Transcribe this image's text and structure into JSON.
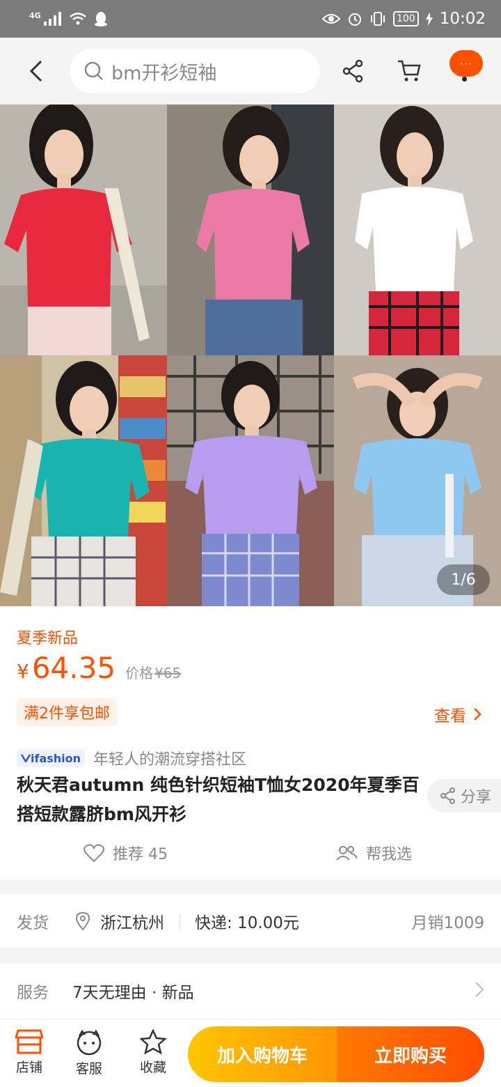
{
  "status_bar": {
    "network": "4G",
    "battery": "100",
    "time": "10:02"
  },
  "search": {
    "query": "bm开衫短袖"
  },
  "gallery": {
    "counter": "1/6",
    "shirt_colors": [
      "#e8283c",
      "#ec7aa6",
      "#ffffff",
      "#18b5b0",
      "#b79cf0",
      "#8ec7f0"
    ]
  },
  "product": {
    "promo_tag": "夏季新品",
    "currency": "¥",
    "price": "64.35",
    "original_price_label": "价格",
    "original_price": "¥65",
    "shipping_badge": "满2件享包邮",
    "view_label": "查看",
    "brand_logo": "ifashion",
    "brand_tagline": "年轻人的潮流穿搭社区",
    "title": "秋天君autumn 纯色针织短袖T恤女2020年夏季百搭短款露脐bm风开衫",
    "share_label": "分享",
    "recommend_label": "推荐 45",
    "help_choose_label": "帮我选"
  },
  "delivery": {
    "label": "发货",
    "city": "浙江杭州",
    "express": "快递: 10.00元",
    "monthly_sales": "月销1009"
  },
  "service": {
    "label": "服务",
    "value": "7天无理由 · 新品"
  },
  "bottom_bar": {
    "shop_label": "店铺",
    "service_label": "客服",
    "favorite_label": "收藏",
    "add_to_cart": "加入购物车",
    "buy_now": "立即购买"
  },
  "colors": {
    "accent": "#ff5000",
    "cart_button": "#ffb000",
    "buy_button": "#ff5a00"
  }
}
